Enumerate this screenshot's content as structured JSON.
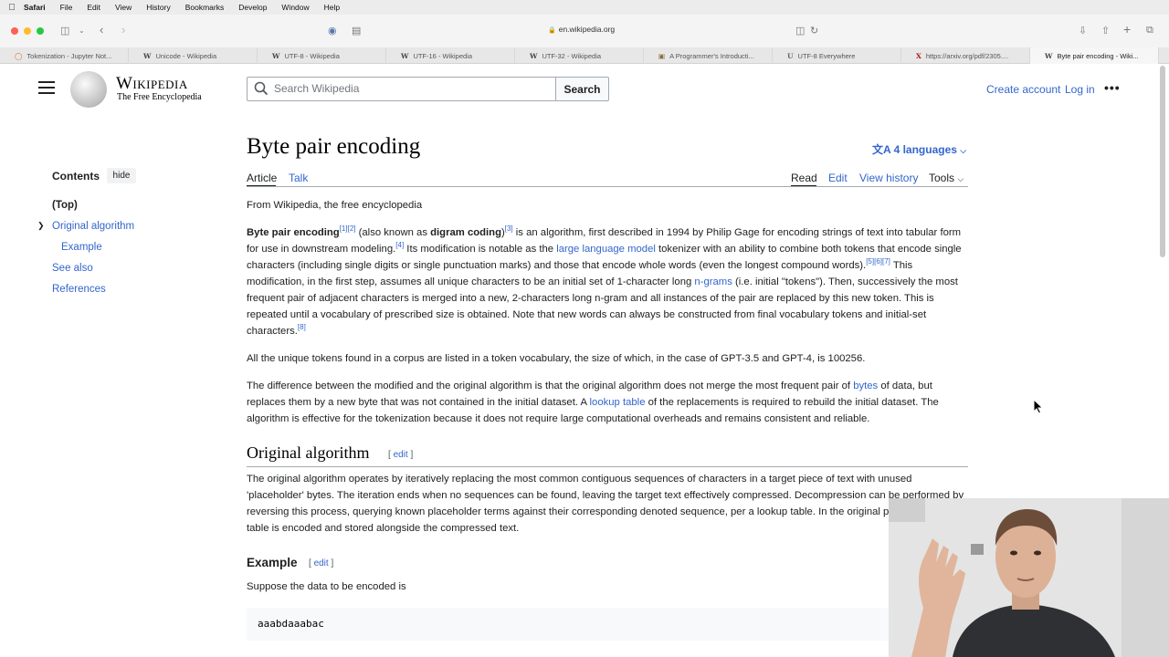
{
  "menubar": {
    "items": [
      "Safari",
      "File",
      "Edit",
      "View",
      "History",
      "Bookmarks",
      "Develop",
      "Window",
      "Help"
    ]
  },
  "browser": {
    "url": "en.wikipedia.org",
    "tabs": [
      {
        "label": "Tokenization - Jupyter Not...",
        "icon": "jupyter-icon"
      },
      {
        "label": "Unicode - Wikipedia",
        "icon": "wikipedia-icon"
      },
      {
        "label": "UTF-8 - Wikipedia",
        "icon": "wikipedia-icon"
      },
      {
        "label": "UTF-16 - Wikipedia",
        "icon": "wikipedia-icon"
      },
      {
        "label": "UTF-32 - Wikipedia",
        "icon": "wikipedia-icon"
      },
      {
        "label": "A Programmer's Introducti...",
        "icon": "page-icon"
      },
      {
        "label": "UTF-8 Everywhere",
        "icon": "utf8-icon"
      },
      {
        "label": "https://arxiv.org/pdf/2305....",
        "icon": "arxiv-icon"
      },
      {
        "label": "Byte pair encoding - Wiki...",
        "icon": "wikipedia-icon",
        "active": true
      }
    ]
  },
  "header": {
    "logo_word": "Wikipedia",
    "logo_tagline": "The Free Encyclopedia",
    "search_placeholder": "Search Wikipedia",
    "search_button": "Search",
    "create_account": "Create account",
    "login": "Log in",
    "more": "•••"
  },
  "toc": {
    "title": "Contents",
    "hide": "hide",
    "items": [
      "(Top)",
      "Original algorithm",
      "Example",
      "See also",
      "References"
    ]
  },
  "article": {
    "title": "Byte pair encoding",
    "languages": "4 languages",
    "tabs": {
      "article": "Article",
      "talk": "Talk",
      "read": "Read",
      "edit": "Edit",
      "history": "View history",
      "tools": "Tools"
    },
    "from": "From Wikipedia, the free encyclopedia",
    "p1": {
      "b1": "Byte pair encoding",
      "r12": "[1][2]",
      "t1": " (also known as ",
      "b2": "digram coding",
      "t1b": ")",
      "r3": "[3]",
      "t2": " is an algorithm, first described in 1994 by Philip Gage for encoding strings of text into tabular form for use in downstream modeling.",
      "r4": "[4]",
      "t3": " Its modification is notable as the ",
      "l1": "large language model",
      "t4": " tokenizer with an ability to combine both tokens that encode single characters (including single digits or single punctuation marks) and those that encode whole words (even the longest compound words).",
      "r567": "[5][6][7]",
      "t5": " This modification, in the first step, assumes all unique characters to be an initial set of 1-character long ",
      "l2": "n-grams",
      "t6": " (i.e. initial \"tokens\"). Then, successively the most frequent pair of adjacent characters is merged into a new, 2-characters long n-gram and all instances of the pair are replaced by this new token. This is repeated until a vocabulary of prescribed size is obtained. Note that new words can always be constructed from final vocabulary tokens and initial-set characters.",
      "r8": "[8]"
    },
    "p2": "All the unique tokens found in a corpus are listed in a token vocabulary, the size of which, in the case of GPT-3.5 and GPT-4, is 100256.",
    "p3": {
      "t1": "The difference between the modified and the original algorithm is that the original algorithm does not merge the most frequent pair of ",
      "l1": "bytes",
      "t2": " of data, but replaces them by a new byte that was not contained in the initial dataset. A ",
      "l2": "lookup table",
      "t3": " of the replacements is required to rebuild the initial dataset. The algorithm is effective for the tokenization because it does not require large computational overheads and remains consistent and reliable."
    },
    "h_original": "Original algorithm",
    "edit_word": "edit",
    "p4": "The original algorithm operates by iteratively replacing the most common contiguous sequences of characters in a target piece of text with unused 'placeholder' bytes. The iteration ends when no sequences can be found, leaving the target text effectively compressed. Decompression can be performed by reversing this process, querying known placeholder terms against their corresponding denoted sequence, per a lookup table. In the original paper, this lookup table is encoded and stored alongside the compressed text.",
    "h_example": "Example",
    "p5": "Suppose the data to be encoded is",
    "code": "aaabdaaabac"
  },
  "colors": {
    "link": "#3366cc",
    "text": "#202122",
    "rule": "#a2a9b1"
  }
}
